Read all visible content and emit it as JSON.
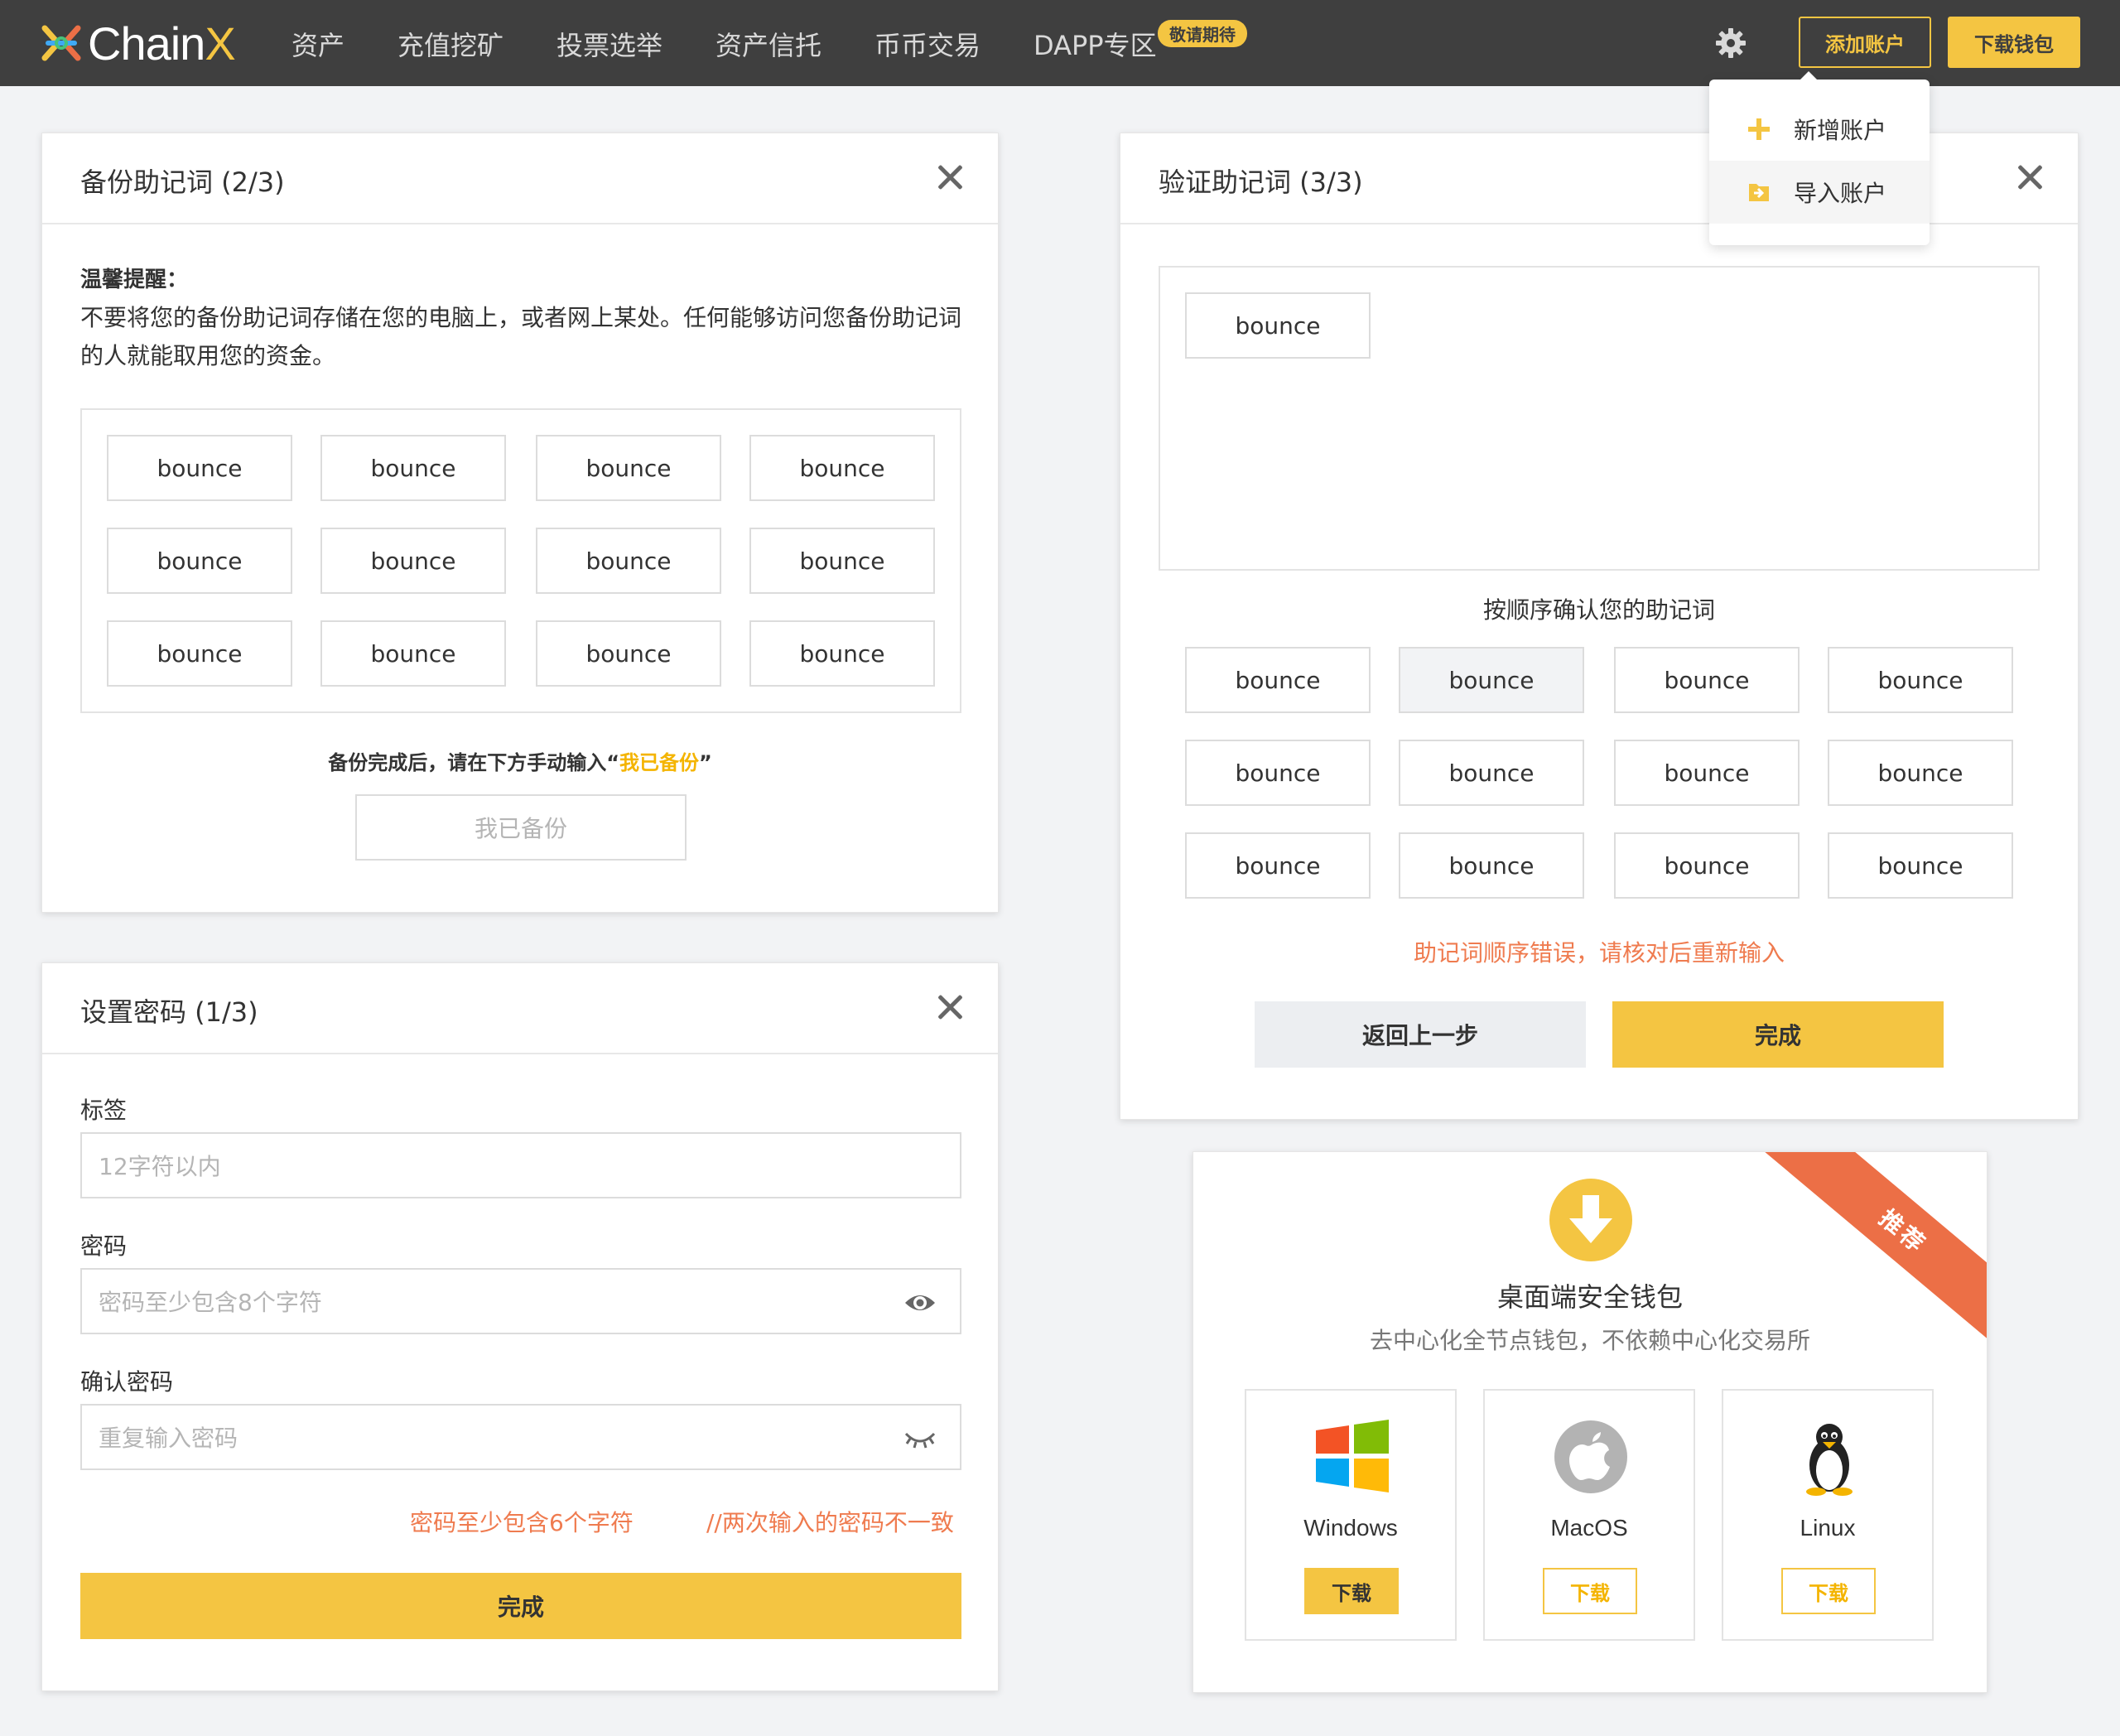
{
  "nav": {
    "logo_main": "Chain",
    "logo_x": "X",
    "items": [
      "资产",
      "充值挖矿",
      "投票选举",
      "资产信托",
      "币币交易",
      "DAPP专区"
    ],
    "badge": "敬请期待",
    "add_account": "添加账户",
    "download_wallet": "下载钱包"
  },
  "dropdown": {
    "items": [
      {
        "label": "新增账户",
        "icon": "plus-icon"
      },
      {
        "label": "导入账户",
        "icon": "import-icon"
      }
    ]
  },
  "backup": {
    "title": "备份助记词 (2/3)",
    "tip_title": "温馨提醒：",
    "tip_body": "不要将您的备份助记词存储在您的电脑上，或者网上某处。任何能够访问您备份助记词的人就能取用您的资金。",
    "words": [
      "bounce",
      "bounce",
      "bounce",
      "bounce",
      "bounce",
      "bounce",
      "bounce",
      "bounce",
      "bounce",
      "bounce",
      "bounce",
      "bounce"
    ],
    "hint_prefix": "备份完成后，请在下方手动输入“",
    "hint_highlight": "我已备份",
    "hint_suffix": "”",
    "input_placeholder": "我已备份"
  },
  "password": {
    "title": "设置密码 (1/3)",
    "label_tag": "标签",
    "tag_placeholder": "12字符以内",
    "label_password": "密码",
    "password_placeholder": "密码至少包含8个字符",
    "label_confirm": "确认密码",
    "confirm_placeholder": "重复输入密码",
    "error_length": "密码至少包含6个字符",
    "error_mismatch": "//两次输入的密码不一致",
    "submit": "完成"
  },
  "verify": {
    "title": "验证助记词 (3/3)",
    "selected_words": [
      "bounce"
    ],
    "subtitle": "按顺序确认您的助记词",
    "words": [
      "bounce",
      "bounce",
      "bounce",
      "bounce",
      "bounce",
      "bounce",
      "bounce",
      "bounce",
      "bounce",
      "bounce",
      "bounce",
      "bounce"
    ],
    "error": "助记词顺序错误，请核对后重新输入",
    "back": "返回上一步",
    "done": "完成"
  },
  "download": {
    "ribbon": "推荐",
    "title": "桌面端安全钱包",
    "subtitle": "去中心化全节点钱包，不依赖中心化交易所",
    "os": [
      {
        "name": "Windows",
        "button": "下载"
      },
      {
        "name": "MacOS",
        "button": "下载"
      },
      {
        "name": "Linux",
        "button": "下载"
      }
    ]
  },
  "colors": {
    "accent": "#f4c542",
    "error": "#ef7b4f",
    "topbar": "#3f3f3f",
    "ribbon": "#ec6f46"
  }
}
